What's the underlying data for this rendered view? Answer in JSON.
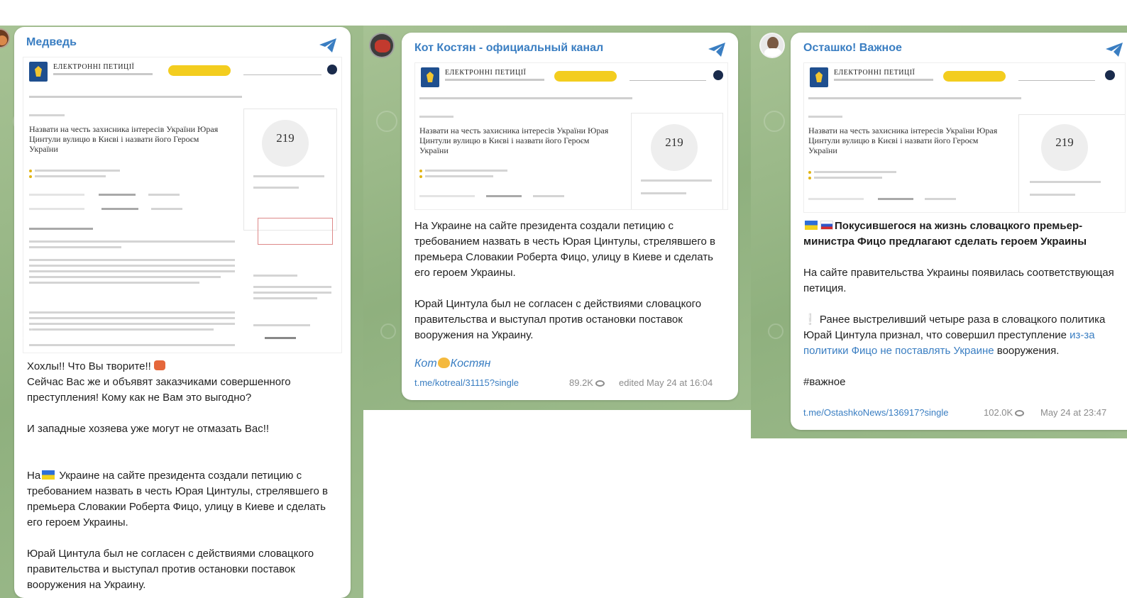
{
  "posts": [
    {
      "channel": "Медведь",
      "screenshot": {
        "site_title": "ЕЛЕКТРОННІ ПЕТИЦІЇ",
        "petition_title": "Назвати на честь захисника інтересів України Юрая Цинтули вулицю в Києві і назвати його Героєм України",
        "signatures": "219"
      },
      "text": [
        "Хохлы!! Что Вы творите!!",
        "Сейчас Вас же и объявят заказчиками совершенного преступления! Кому как не Вам это выгодно?",
        "И западные хозяева уже могут не отмазать Вас!!",
        "На",
        "Украине на сайте президента создали петицию с требованием назвать в честь Юрая Цинтулы, стрелявшего в премьера Словакии Роберта Фицо, улицу в Киеве и сделать его героем Украины.",
        "Юрай Цинтула был не согласен с действиями словацкого правительства и выступал против остановки поставок вооружения на Украину."
      ]
    },
    {
      "channel": "Кот Костян - официальный канал",
      "screenshot": {
        "site_title": "ЕЛЕКТРОННІ ПЕТИЦІЇ",
        "petition_title": "Назвати на честь захисника інтересів України Юрая Цинтули вулицю в Києві і назвати його Героєм України",
        "signatures": "219"
      },
      "text": [
        "На Украине на сайте президента создали петицию с требованием назвать в честь Юрая Цинтулы, стрелявшего в премьера Словакии Роберта Фицо, улицу в Киеве и сделать его героем Украины.",
        "Юрай Цинтула был не согласен с действиями словацкого правительства и выступал против остановки поставок вооружения на Украину."
      ],
      "signature_parts": [
        "Кот",
        "Костян"
      ],
      "link": "t.me/kotreal/31115?single",
      "views": "89.2K",
      "time": "edited May 24 at 16:04"
    },
    {
      "channel": "Осташко! Важное",
      "screenshot": {
        "site_title": "ЕЛЕКТРОННІ ПЕТИЦІЇ",
        "petition_title": "Назвати на честь захисника інтересів України Юрая Цинтули вулицю в Києві і назвати його Героєм України",
        "signatures": "219"
      },
      "headline": "Покусившегося на жизнь словацкого премьер-министра Фицо предлагают сделать героем Украины",
      "text": [
        "На сайте правительства Украины появилась соответствующая петиция.",
        "Ранее выстреливший четыре раза в словацкого политика Юрай Цинтула признал, что совершил преступление",
        "из-за политики Фицо не поставлять Украине",
        "вооружения.",
        "#важное"
      ],
      "link": "t.me/OstashkoNews/136917?single",
      "views": "102.0K",
      "time": "May 24 at 23:47"
    }
  ],
  "colors": {
    "link": "#3a7ec2",
    "background": "#9ab88a",
    "card": "#ffffff",
    "accent_yellow": "#f3cd1f"
  },
  "icons": [
    "telegram-send-icon",
    "eye-icon",
    "ukraine-flag-icon",
    "russia-flag-icon",
    "cat-emoji-icon",
    "angry-emoji-icon",
    "exclamation-icon"
  ]
}
